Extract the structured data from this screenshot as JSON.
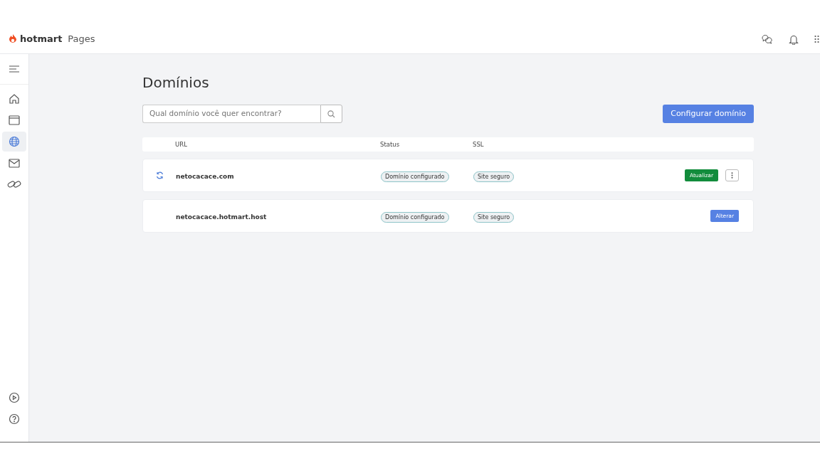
{
  "header": {
    "brand": "hotmart",
    "product": "Pages"
  },
  "sidebar": {
    "items": [
      {
        "kind": "home",
        "selected": false
      },
      {
        "kind": "window",
        "selected": false
      },
      {
        "kind": "globe",
        "selected": true
      },
      {
        "kind": "mail",
        "selected": false
      },
      {
        "kind": "link",
        "selected": false
      }
    ],
    "bottom_items": [
      {
        "kind": "play",
        "selected": false
      },
      {
        "kind": "help",
        "selected": false
      }
    ]
  },
  "page": {
    "title": "Domínios",
    "search": {
      "placeholder": "Qual domínio você quer encontrar?"
    },
    "primary_button": "Configurar domínio"
  },
  "table": {
    "columns": [
      "URL",
      "Status",
      "SSL"
    ],
    "rows": [
      {
        "syncing": true,
        "url": "netocacace.com",
        "status": "Domínio configurado",
        "ssl": "Site seguro",
        "actions": [
          {
            "kind": "update",
            "label": "Atualizar"
          },
          {
            "kind": "more"
          }
        ]
      },
      {
        "syncing": false,
        "url": "netocacace.hotmart.host",
        "status": "Domínio configurado",
        "ssl": "Site seguro",
        "actions": [
          {
            "kind": "edit",
            "label": "Alterar"
          }
        ]
      }
    ]
  }
}
